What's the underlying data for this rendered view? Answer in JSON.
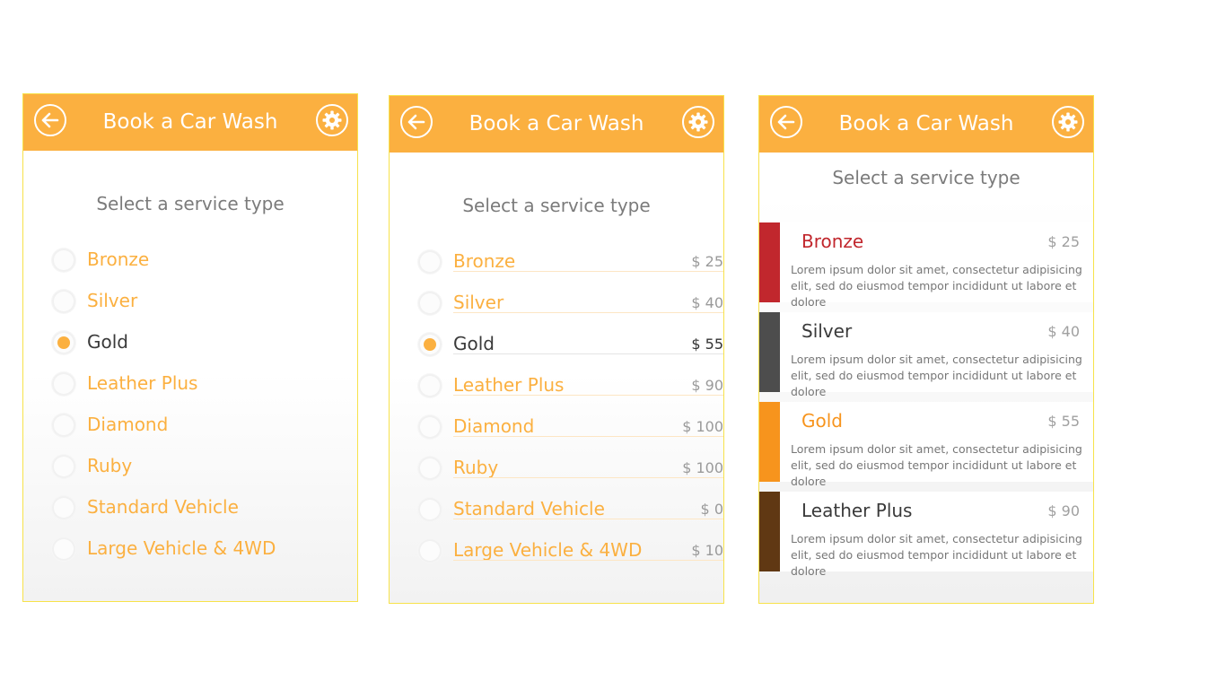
{
  "header": {
    "title": "Book a Car Wash"
  },
  "subtitle": "Select a service type",
  "options": [
    {
      "label": "Bronze",
      "price": "$ 25",
      "selected": false
    },
    {
      "label": "Silver",
      "price": "$ 40",
      "selected": false
    },
    {
      "label": "Gold",
      "price": "$ 55",
      "selected": true
    },
    {
      "label": "Leather Plus",
      "price": "$ 90",
      "selected": false
    },
    {
      "label": "Diamond",
      "price": "$ 100",
      "selected": false
    },
    {
      "label": "Ruby",
      "price": "$ 100",
      "selected": false
    },
    {
      "label": "Standard Vehicle",
      "price": "$ 0",
      "selected": false
    },
    {
      "label": "Large Vehicle & 4WD",
      "price": "$ 10",
      "selected": false
    }
  ],
  "cards": [
    {
      "label": "Bronze",
      "price": "$ 25",
      "color": "#c1272d",
      "label_color": "#c1272d",
      "desc": "Lorem ipsum dolor sit amet, consectetur adipisicing elit, sed do eiusmod tempor incididunt ut labore et dolore"
    },
    {
      "label": "Silver",
      "price": "$ 40",
      "color": "#4d4d4d",
      "label_color": "#3a3a3a",
      "desc": "Lorem ipsum dolor sit amet, consectetur adipisicing elit, sed do eiusmod tempor incididunt ut labore et dolore"
    },
    {
      "label": "Gold",
      "price": "$ 55",
      "color": "#f7941d",
      "label_color": "#f7941d",
      "desc": "Lorem ipsum dolor sit amet, consectetur adipisicing elit, sed do eiusmod tempor incididunt ut labore et dolore"
    },
    {
      "label": "Leather Plus",
      "price": "$ 90",
      "color": "#603813",
      "label_color": "#3a3a3a",
      "desc": "Lorem ipsum dolor sit amet, consectetur adipisicing elit, sed do eiusmod tempor incididunt ut labore et dolore"
    }
  ],
  "icons": {
    "back": "back-arrow-icon",
    "settings": "gear-icon"
  },
  "colors": {
    "accent": "#fbb040",
    "panel_border": "#f7e24a"
  }
}
